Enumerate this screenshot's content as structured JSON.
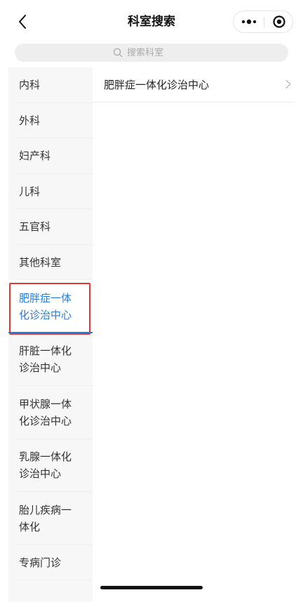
{
  "header": {
    "title": "科室搜索",
    "back_icon": "chevron-left-icon",
    "more_icon": "more-dots-icon",
    "close_icon": "target-circle-icon"
  },
  "search": {
    "placeholder": "搜索科室",
    "value": ""
  },
  "categories": [
    {
      "label": "内科",
      "selected": false
    },
    {
      "label": "外科",
      "selected": false
    },
    {
      "label": "妇产科",
      "selected": false
    },
    {
      "label": "儿科",
      "selected": false
    },
    {
      "label": "五官科",
      "selected": false
    },
    {
      "label": "其他科室",
      "selected": false
    },
    {
      "label_line1": "肥胖症一体",
      "label_line2": "化诊治中心",
      "selected": true
    },
    {
      "label_line1": "肝脏一体化",
      "label_line2": "诊治中心",
      "selected": false
    },
    {
      "label_line1": "甲状腺一体",
      "label_line2": "化诊治中心",
      "selected": false
    },
    {
      "label_line1": "乳腺一体化",
      "label_line2": "诊治中心",
      "selected": false
    },
    {
      "label_line1": "胎儿疾病一",
      "label_line2": "体化",
      "selected": false
    },
    {
      "label": "专病门诊",
      "selected": false
    }
  ],
  "subdepartments": [
    {
      "label": "肥胖症一体化诊治中心"
    }
  ],
  "colors": {
    "accent": "#2b7cd3",
    "highlight_border": "#e53935",
    "sidebar_bg": "#f7f7f7"
  }
}
